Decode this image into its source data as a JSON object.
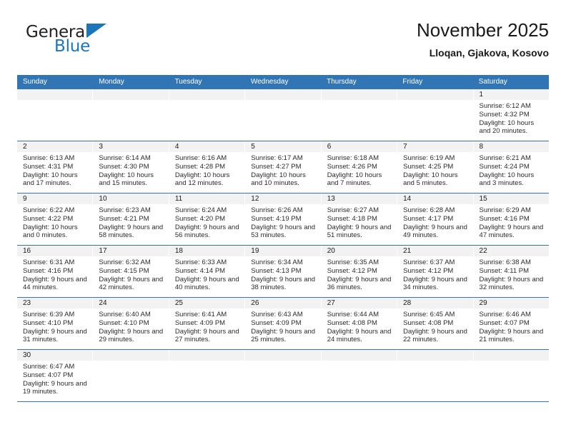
{
  "brand": {
    "name_top": "General",
    "name_bottom": "Blue",
    "color_black": "#231f20",
    "color_blue": "#1b75bb"
  },
  "header": {
    "title": "November 2025",
    "subtitle": "Lloqan, Gjakova, Kosovo"
  },
  "theme": {
    "header_blue": "#3175b4",
    "daynum_strip": "#f2f2f2",
    "text": "#1a1a1a"
  },
  "weekdays": [
    "Sunday",
    "Monday",
    "Tuesday",
    "Wednesday",
    "Thursday",
    "Friday",
    "Saturday"
  ],
  "weeks": [
    [
      {
        "day": "",
        "sunrise": "",
        "sunset": "",
        "daylight": ""
      },
      {
        "day": "",
        "sunrise": "",
        "sunset": "",
        "daylight": ""
      },
      {
        "day": "",
        "sunrise": "",
        "sunset": "",
        "daylight": ""
      },
      {
        "day": "",
        "sunrise": "",
        "sunset": "",
        "daylight": ""
      },
      {
        "day": "",
        "sunrise": "",
        "sunset": "",
        "daylight": ""
      },
      {
        "day": "",
        "sunrise": "",
        "sunset": "",
        "daylight": ""
      },
      {
        "day": "1",
        "sunrise": "Sunrise: 6:12 AM",
        "sunset": "Sunset: 4:32 PM",
        "daylight": "Daylight: 10 hours and 20 minutes."
      }
    ],
    [
      {
        "day": "2",
        "sunrise": "Sunrise: 6:13 AM",
        "sunset": "Sunset: 4:31 PM",
        "daylight": "Daylight: 10 hours and 17 minutes."
      },
      {
        "day": "3",
        "sunrise": "Sunrise: 6:14 AM",
        "sunset": "Sunset: 4:30 PM",
        "daylight": "Daylight: 10 hours and 15 minutes."
      },
      {
        "day": "4",
        "sunrise": "Sunrise: 6:16 AM",
        "sunset": "Sunset: 4:28 PM",
        "daylight": "Daylight: 10 hours and 12 minutes."
      },
      {
        "day": "5",
        "sunrise": "Sunrise: 6:17 AM",
        "sunset": "Sunset: 4:27 PM",
        "daylight": "Daylight: 10 hours and 10 minutes."
      },
      {
        "day": "6",
        "sunrise": "Sunrise: 6:18 AM",
        "sunset": "Sunset: 4:26 PM",
        "daylight": "Daylight: 10 hours and 7 minutes."
      },
      {
        "day": "7",
        "sunrise": "Sunrise: 6:19 AM",
        "sunset": "Sunset: 4:25 PM",
        "daylight": "Daylight: 10 hours and 5 minutes."
      },
      {
        "day": "8",
        "sunrise": "Sunrise: 6:21 AM",
        "sunset": "Sunset: 4:24 PM",
        "daylight": "Daylight: 10 hours and 3 minutes."
      }
    ],
    [
      {
        "day": "9",
        "sunrise": "Sunrise: 6:22 AM",
        "sunset": "Sunset: 4:22 PM",
        "daylight": "Daylight: 10 hours and 0 minutes."
      },
      {
        "day": "10",
        "sunrise": "Sunrise: 6:23 AM",
        "sunset": "Sunset: 4:21 PM",
        "daylight": "Daylight: 9 hours and 58 minutes."
      },
      {
        "day": "11",
        "sunrise": "Sunrise: 6:24 AM",
        "sunset": "Sunset: 4:20 PM",
        "daylight": "Daylight: 9 hours and 56 minutes."
      },
      {
        "day": "12",
        "sunrise": "Sunrise: 6:26 AM",
        "sunset": "Sunset: 4:19 PM",
        "daylight": "Daylight: 9 hours and 53 minutes."
      },
      {
        "day": "13",
        "sunrise": "Sunrise: 6:27 AM",
        "sunset": "Sunset: 4:18 PM",
        "daylight": "Daylight: 9 hours and 51 minutes."
      },
      {
        "day": "14",
        "sunrise": "Sunrise: 6:28 AM",
        "sunset": "Sunset: 4:17 PM",
        "daylight": "Daylight: 9 hours and 49 minutes."
      },
      {
        "day": "15",
        "sunrise": "Sunrise: 6:29 AM",
        "sunset": "Sunset: 4:16 PM",
        "daylight": "Daylight: 9 hours and 47 minutes."
      }
    ],
    [
      {
        "day": "16",
        "sunrise": "Sunrise: 6:31 AM",
        "sunset": "Sunset: 4:16 PM",
        "daylight": "Daylight: 9 hours and 44 minutes."
      },
      {
        "day": "17",
        "sunrise": "Sunrise: 6:32 AM",
        "sunset": "Sunset: 4:15 PM",
        "daylight": "Daylight: 9 hours and 42 minutes."
      },
      {
        "day": "18",
        "sunrise": "Sunrise: 6:33 AM",
        "sunset": "Sunset: 4:14 PM",
        "daylight": "Daylight: 9 hours and 40 minutes."
      },
      {
        "day": "19",
        "sunrise": "Sunrise: 6:34 AM",
        "sunset": "Sunset: 4:13 PM",
        "daylight": "Daylight: 9 hours and 38 minutes."
      },
      {
        "day": "20",
        "sunrise": "Sunrise: 6:35 AM",
        "sunset": "Sunset: 4:12 PM",
        "daylight": "Daylight: 9 hours and 36 minutes."
      },
      {
        "day": "21",
        "sunrise": "Sunrise: 6:37 AM",
        "sunset": "Sunset: 4:12 PM",
        "daylight": "Daylight: 9 hours and 34 minutes."
      },
      {
        "day": "22",
        "sunrise": "Sunrise: 6:38 AM",
        "sunset": "Sunset: 4:11 PM",
        "daylight": "Daylight: 9 hours and 32 minutes."
      }
    ],
    [
      {
        "day": "23",
        "sunrise": "Sunrise: 6:39 AM",
        "sunset": "Sunset: 4:10 PM",
        "daylight": "Daylight: 9 hours and 31 minutes."
      },
      {
        "day": "24",
        "sunrise": "Sunrise: 6:40 AM",
        "sunset": "Sunset: 4:10 PM",
        "daylight": "Daylight: 9 hours and 29 minutes."
      },
      {
        "day": "25",
        "sunrise": "Sunrise: 6:41 AM",
        "sunset": "Sunset: 4:09 PM",
        "daylight": "Daylight: 9 hours and 27 minutes."
      },
      {
        "day": "26",
        "sunrise": "Sunrise: 6:43 AM",
        "sunset": "Sunset: 4:09 PM",
        "daylight": "Daylight: 9 hours and 25 minutes."
      },
      {
        "day": "27",
        "sunrise": "Sunrise: 6:44 AM",
        "sunset": "Sunset: 4:08 PM",
        "daylight": "Daylight: 9 hours and 24 minutes."
      },
      {
        "day": "28",
        "sunrise": "Sunrise: 6:45 AM",
        "sunset": "Sunset: 4:08 PM",
        "daylight": "Daylight: 9 hours and 22 minutes."
      },
      {
        "day": "29",
        "sunrise": "Sunrise: 6:46 AM",
        "sunset": "Sunset: 4:07 PM",
        "daylight": "Daylight: 9 hours and 21 minutes."
      }
    ],
    [
      {
        "day": "30",
        "sunrise": "Sunrise: 6:47 AM",
        "sunset": "Sunset: 4:07 PM",
        "daylight": "Daylight: 9 hours and 19 minutes."
      },
      {
        "day": "",
        "sunrise": "",
        "sunset": "",
        "daylight": ""
      },
      {
        "day": "",
        "sunrise": "",
        "sunset": "",
        "daylight": ""
      },
      {
        "day": "",
        "sunrise": "",
        "sunset": "",
        "daylight": ""
      },
      {
        "day": "",
        "sunrise": "",
        "sunset": "",
        "daylight": ""
      },
      {
        "day": "",
        "sunrise": "",
        "sunset": "",
        "daylight": ""
      },
      {
        "day": "",
        "sunrise": "",
        "sunset": "",
        "daylight": ""
      }
    ]
  ]
}
